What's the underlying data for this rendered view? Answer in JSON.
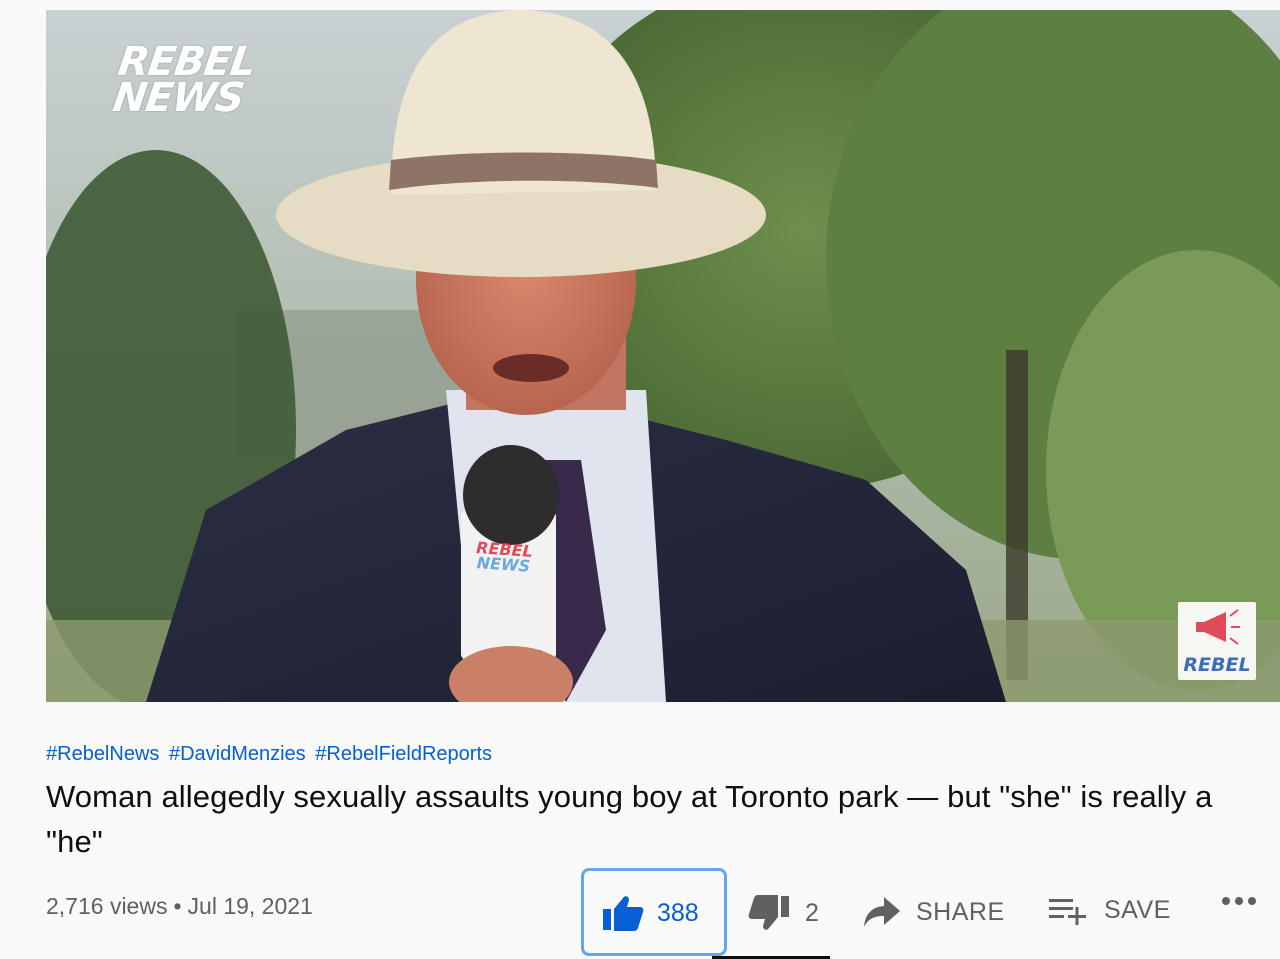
{
  "video": {
    "watermark_top_left": [
      "REBEL",
      "NEWS"
    ],
    "mic_logo": [
      "REBEL",
      "NEWS"
    ],
    "corner_badge": "REBEL"
  },
  "hashtags": [
    "#RebelNews",
    "#DavidMenzies",
    "#RebelFieldReports"
  ],
  "title": "Woman allegedly sexually assaults young boy at Toronto park — but \"she\" is really a \"he\"",
  "meta": {
    "views": "2,716 views",
    "separator": "•",
    "date": "Jul 19, 2021"
  },
  "actions": {
    "likes": "388",
    "dislikes": "2",
    "share": "SHARE",
    "save": "SAVE"
  },
  "colors": {
    "link_blue": "#065fd4",
    "like_highlight": "#62a5f0",
    "secondary_text": "#606060",
    "primary_text": "#0f0f0f"
  }
}
